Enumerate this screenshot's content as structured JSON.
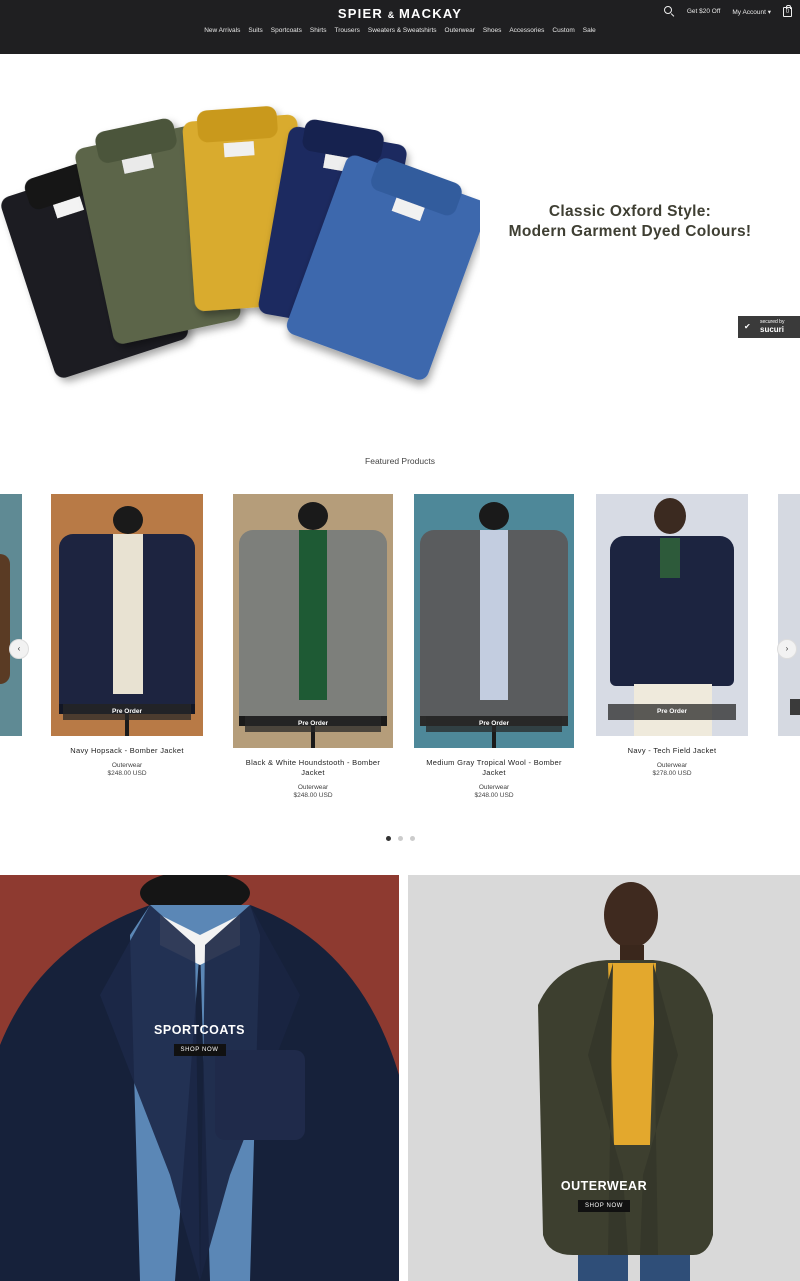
{
  "header": {
    "logo_left": "SPIER",
    "logo_amp": "&",
    "logo_right": "MACKAY",
    "promo": "Get $20 Off",
    "account": "My Account ▾",
    "bag_count": "0",
    "nav": [
      "New Arrivals",
      "Suits",
      "Sportcoats",
      "Shirts",
      "Trousers",
      "Sweaters & Sweatshirts",
      "Outerwear",
      "Shoes",
      "Accessories",
      "Custom",
      "Sale"
    ]
  },
  "hero": {
    "headline_line1": "Classic Oxford Style:",
    "headline_line2": "Modern Garment Dyed Colours!",
    "badge_top": "secured by",
    "badge_brand": "sucuri"
  },
  "featured": {
    "title": "Featured Products",
    "products": [
      {
        "name": "Navy Hopsack - Bomber Jacket",
        "category": "Outerwear",
        "price": "$248.00 USD",
        "badge": "Pre Order"
      },
      {
        "name": "Black & White Houndstooth - Bomber Jacket",
        "category": "Outerwear",
        "price": "$248.00 USD",
        "badge": "Pre Order"
      },
      {
        "name": "Medium Gray Tropical Wool - Bomber Jacket",
        "category": "Outerwear",
        "price": "$248.00 USD",
        "badge": "Pre Order"
      },
      {
        "name": "Navy - Tech Field Jacket",
        "category": "Outerwear",
        "price": "$278.00 USD",
        "badge": "Pre Order"
      }
    ],
    "prev_arrow": "‹",
    "next_arrow": "›"
  },
  "tiles": {
    "sportcoats": {
      "label": "SPORTCOATS",
      "button": "SHOP NOW"
    },
    "outerwear": {
      "label": "OUTERWEAR",
      "button": "SHOP NOW"
    }
  }
}
